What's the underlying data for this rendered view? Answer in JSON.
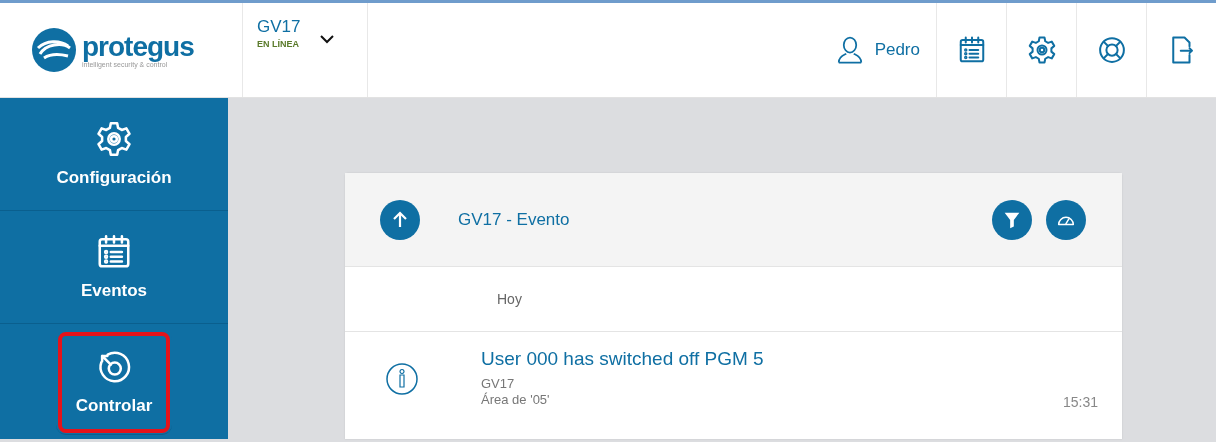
{
  "header": {
    "logo": {
      "name": "protegus",
      "tagline": "intelligent security & control"
    },
    "device": {
      "name": "GV17",
      "status": "EN LÍNEA"
    },
    "user": {
      "name": "Pedro"
    },
    "toolbar": [
      {
        "kind": "calendar"
      },
      {
        "kind": "gear"
      },
      {
        "kind": "lifebuoy"
      },
      {
        "kind": "logout"
      }
    ]
  },
  "sidebar": {
    "items": [
      {
        "kind": "gear",
        "label": "Configuración",
        "highlighted": false
      },
      {
        "kind": "calendar",
        "label": "Eventos",
        "highlighted": false
      },
      {
        "kind": "control",
        "label": "Controlar",
        "highlighted": true
      }
    ]
  },
  "panel": {
    "title": "GV17 - Evento",
    "actions": [
      {
        "kind": "filter"
      },
      {
        "kind": "gauge"
      }
    ],
    "day": "Hoy",
    "events": [
      {
        "title": "User 000 has switched off PGM 5",
        "device": "GV17",
        "area": "Área de '05'",
        "time": "15:31"
      }
    ]
  }
}
